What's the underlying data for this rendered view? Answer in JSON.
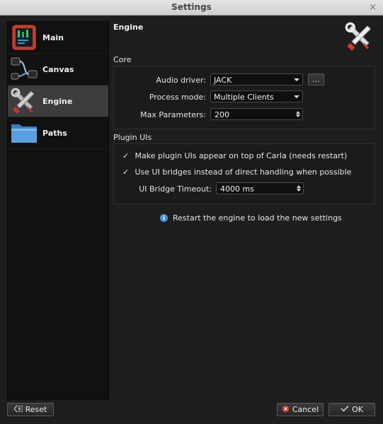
{
  "window": {
    "title": "Settings",
    "close_glyph": "×"
  },
  "sidebar": {
    "items": [
      {
        "label": "Main",
        "icon": "main-icon"
      },
      {
        "label": "Canvas",
        "icon": "canvas-icon"
      },
      {
        "label": "Engine",
        "icon": "engine-icon",
        "selected": true
      },
      {
        "label": "Paths",
        "icon": "folder-icon"
      }
    ]
  },
  "page": {
    "title": "Engine",
    "core_label": "Core",
    "audio_driver_label": "Audio driver:",
    "audio_driver_value": "JACK",
    "more_button": "...",
    "process_mode_label": "Process mode:",
    "process_mode_value": "Multiple Clients",
    "max_params_label": "Max Parameters:",
    "max_params_value": "200",
    "plugin_uis_label": "Plugin UIs",
    "check_ontop_mark": "✓",
    "check_ontop_label": "Make plugin UIs appear on top of Carla (needs restart)",
    "check_bridges_mark": "✓",
    "check_bridges_label": "Use UI bridges instead of direct handling when possible",
    "bridge_timeout_label": "UI Bridge Timeout:",
    "bridge_timeout_value": "4000 ms",
    "info_text": "Restart the engine to load the new settings"
  },
  "buttons": {
    "reset": "Reset",
    "cancel": "Cancel",
    "ok": "OK"
  },
  "colors": {
    "background": "#1e1e1e",
    "sidebar_bg": "#111111",
    "selected_bg": "#3d3d3d",
    "accent_info": "#4a8fd8",
    "cancel_icon": "#c0392b"
  }
}
